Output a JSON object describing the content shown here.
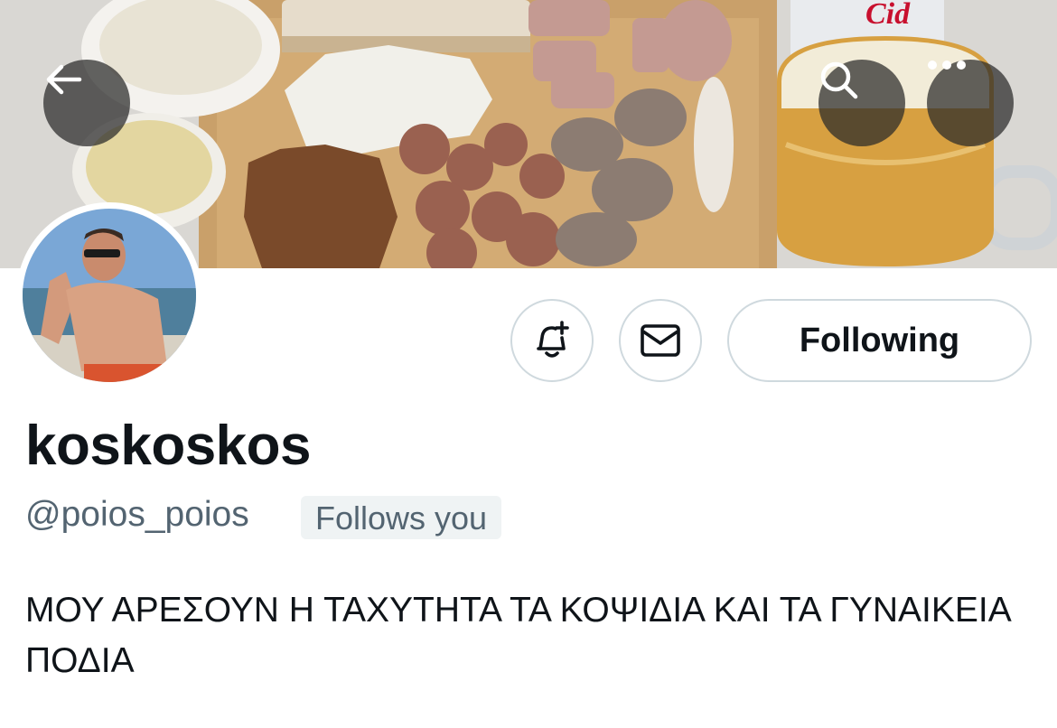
{
  "header": {
    "back_icon": "arrow-left-icon",
    "search_icon": "search-icon",
    "more_icon": "more-horizontal-icon",
    "banner_text": "Cid"
  },
  "actions": {
    "notify_icon": "bell-plus-icon",
    "message_icon": "envelope-icon",
    "following_label": "Following"
  },
  "profile": {
    "display_name": "koskoskos",
    "handle": "@poios_poios",
    "follows_you": "Follows you",
    "bio": "ΜΟΥ ΑΡΕΣΟΥΝ Η ΤΑΧΥΤΗΤΑ ΤΑ ΚΟΨΙΔΙΑ ΚΑΙ ΤΑ ΓΥΝΑΙΚΕΙΑ ΠΟΔΙΑ"
  },
  "colors": {
    "primary_text": "#0f1419",
    "secondary_text": "#536471",
    "border": "#cfd9de",
    "badge_bg": "#eff3f4"
  }
}
